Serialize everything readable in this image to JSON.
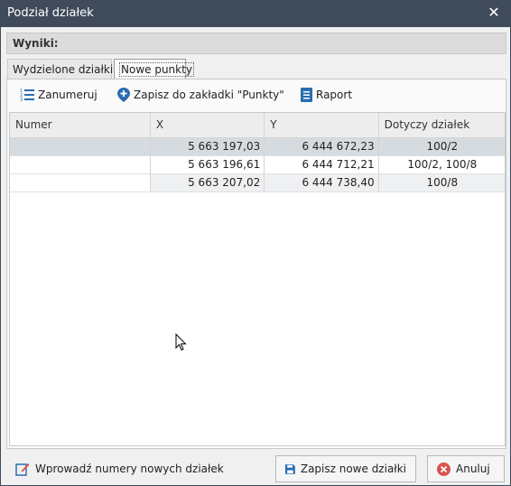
{
  "window": {
    "title": "Podział działek"
  },
  "results_label": "Wyniki:",
  "tabs": [
    {
      "label": "Wydzielone działki"
    },
    {
      "label": "Nowe punkty"
    }
  ],
  "toolbar": {
    "renumber_label": "Zanumeruj",
    "save_to_tab_label": "Zapisz do zakładki \"Punkty\"",
    "report_label": "Raport"
  },
  "table": {
    "columns": [
      "Numer",
      "X",
      "Y",
      "Dotyczy działek"
    ],
    "rows": [
      {
        "numer": "",
        "x": "5 663 197,03",
        "y": "6 444 672,23",
        "dotyczy": "100/2"
      },
      {
        "numer": "",
        "x": "5 663 196,61",
        "y": "6 444 712,21",
        "dotyczy": "100/2, 100/8"
      },
      {
        "numer": "",
        "x": "5 663 207,02",
        "y": "6 444 738,40",
        "dotyczy": "100/8"
      }
    ]
  },
  "footer": {
    "enter_numbers_label": "Wprowadź numery nowych działek",
    "save_label": "Zapisz nowe działki",
    "cancel_label": "Anuluj"
  },
  "colors": {
    "titlebar": "#3f4b5b",
    "accent_blue": "#2b6cb0",
    "cancel_red": "#d9534f",
    "selected_row": "#d6dbe0"
  }
}
